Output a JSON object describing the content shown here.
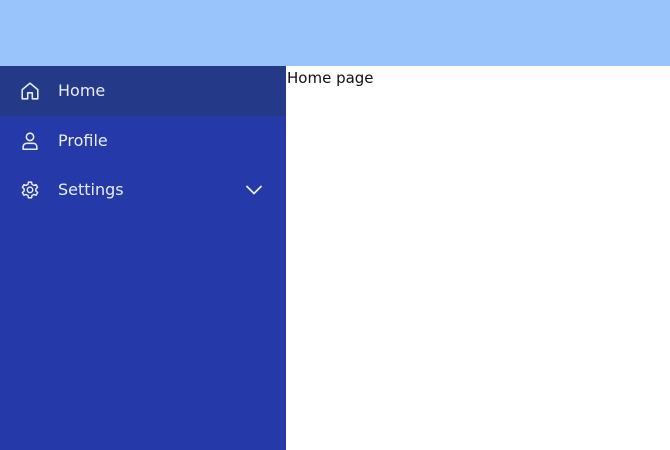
{
  "header": {
    "color": "#99c4fb"
  },
  "sidebar": {
    "color": "#253aa8",
    "active_color": "#243988",
    "items": [
      {
        "label": "Home",
        "icon": "home-icon",
        "active": true
      },
      {
        "label": "Profile",
        "icon": "user-icon",
        "active": false
      },
      {
        "label": "Settings",
        "icon": "gear-icon",
        "active": false,
        "expandable": true,
        "expand_icon": "chevron-down-icon"
      }
    ]
  },
  "main": {
    "text": "Home page"
  }
}
